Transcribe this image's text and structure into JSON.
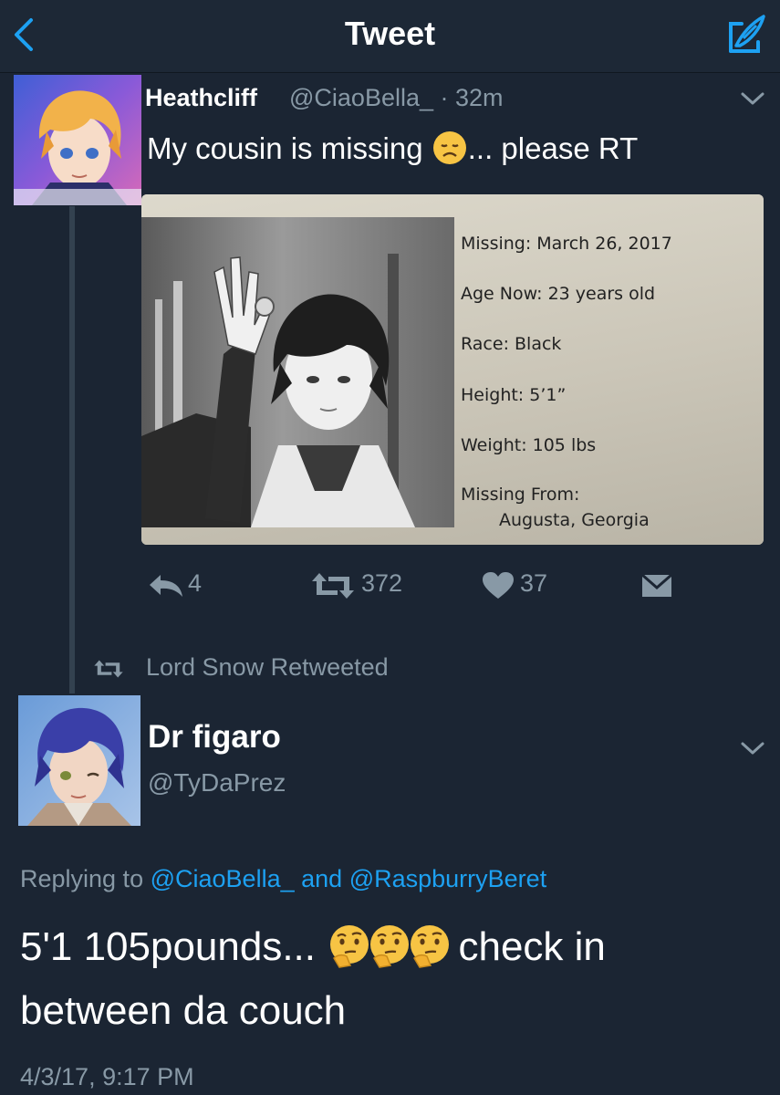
{
  "header": {
    "title": "Tweet",
    "back_icon": "chevron-left-icon",
    "compose_icon": "compose-icon"
  },
  "tweet1": {
    "name": "Heathcliff",
    "handle": "@CiaoBella_",
    "time": "· 32m",
    "text_before": "My cousin is missing",
    "text_after": "... please RT",
    "emoji": "disappointed-face",
    "poster": {
      "missing": "Missing:  March 26, 2017",
      "age": "Age Now:  23 years old",
      "race": "Race:  Black",
      "height": "Height:  5’1”",
      "weight": "Weight:  105 lbs",
      "missing_from_label": "Missing From:",
      "missing_from_value": "Augusta, Georgia"
    },
    "actions": {
      "replies": "4",
      "retweets": "372",
      "likes": "37"
    }
  },
  "retweet_context": {
    "text": "Lord Snow Retweeted"
  },
  "tweet2": {
    "name": "Dr figaro",
    "handle": "@TyDaPrez",
    "replying_prefix": "Replying to",
    "replying_mention1": "@CiaoBella_",
    "replying_and": "and",
    "replying_mention2": "@RaspburryBeret",
    "text_before": "5'1 105pounds...",
    "text_after": "check in between da couch",
    "emoji": "thinking-face",
    "emoji_count": 3,
    "timestamp": "4/3/17, 9:17 PM"
  },
  "colors": {
    "background": "#1b2533",
    "secondary_text": "#8899a6",
    "accent": "#1da1f2"
  }
}
